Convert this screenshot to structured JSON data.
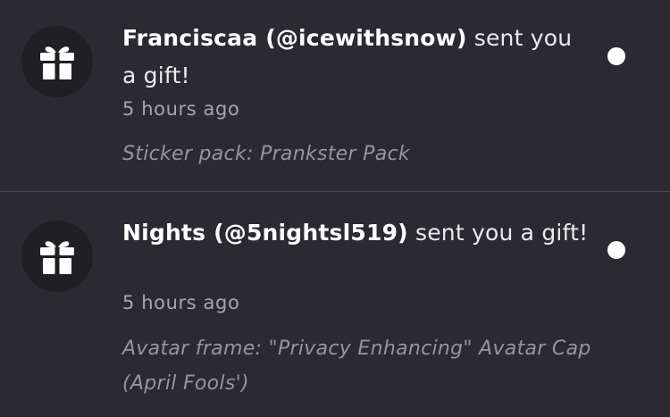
{
  "notifications": [
    {
      "sender": "Franciscaa (@icewithsnow)",
      "action": " sent you a gift!",
      "time": "5 hours ago",
      "detail": "Sticker pack: Prankster Pack",
      "icon": "gift-icon",
      "unread": true
    },
    {
      "sender": "Nights (@5nightsl519)",
      "action": " sent you a gift!",
      "time": "5 hours ago",
      "detail": "Avatar frame: \"Privacy Enhancing\" Avatar Cap (April Fools')",
      "icon": "gift-icon",
      "unread": true
    }
  ],
  "colors": {
    "background": "#2c2a31",
    "avatar_bg": "#201f24",
    "divider": "#4a4850",
    "unread_dot": "#ffffff"
  }
}
